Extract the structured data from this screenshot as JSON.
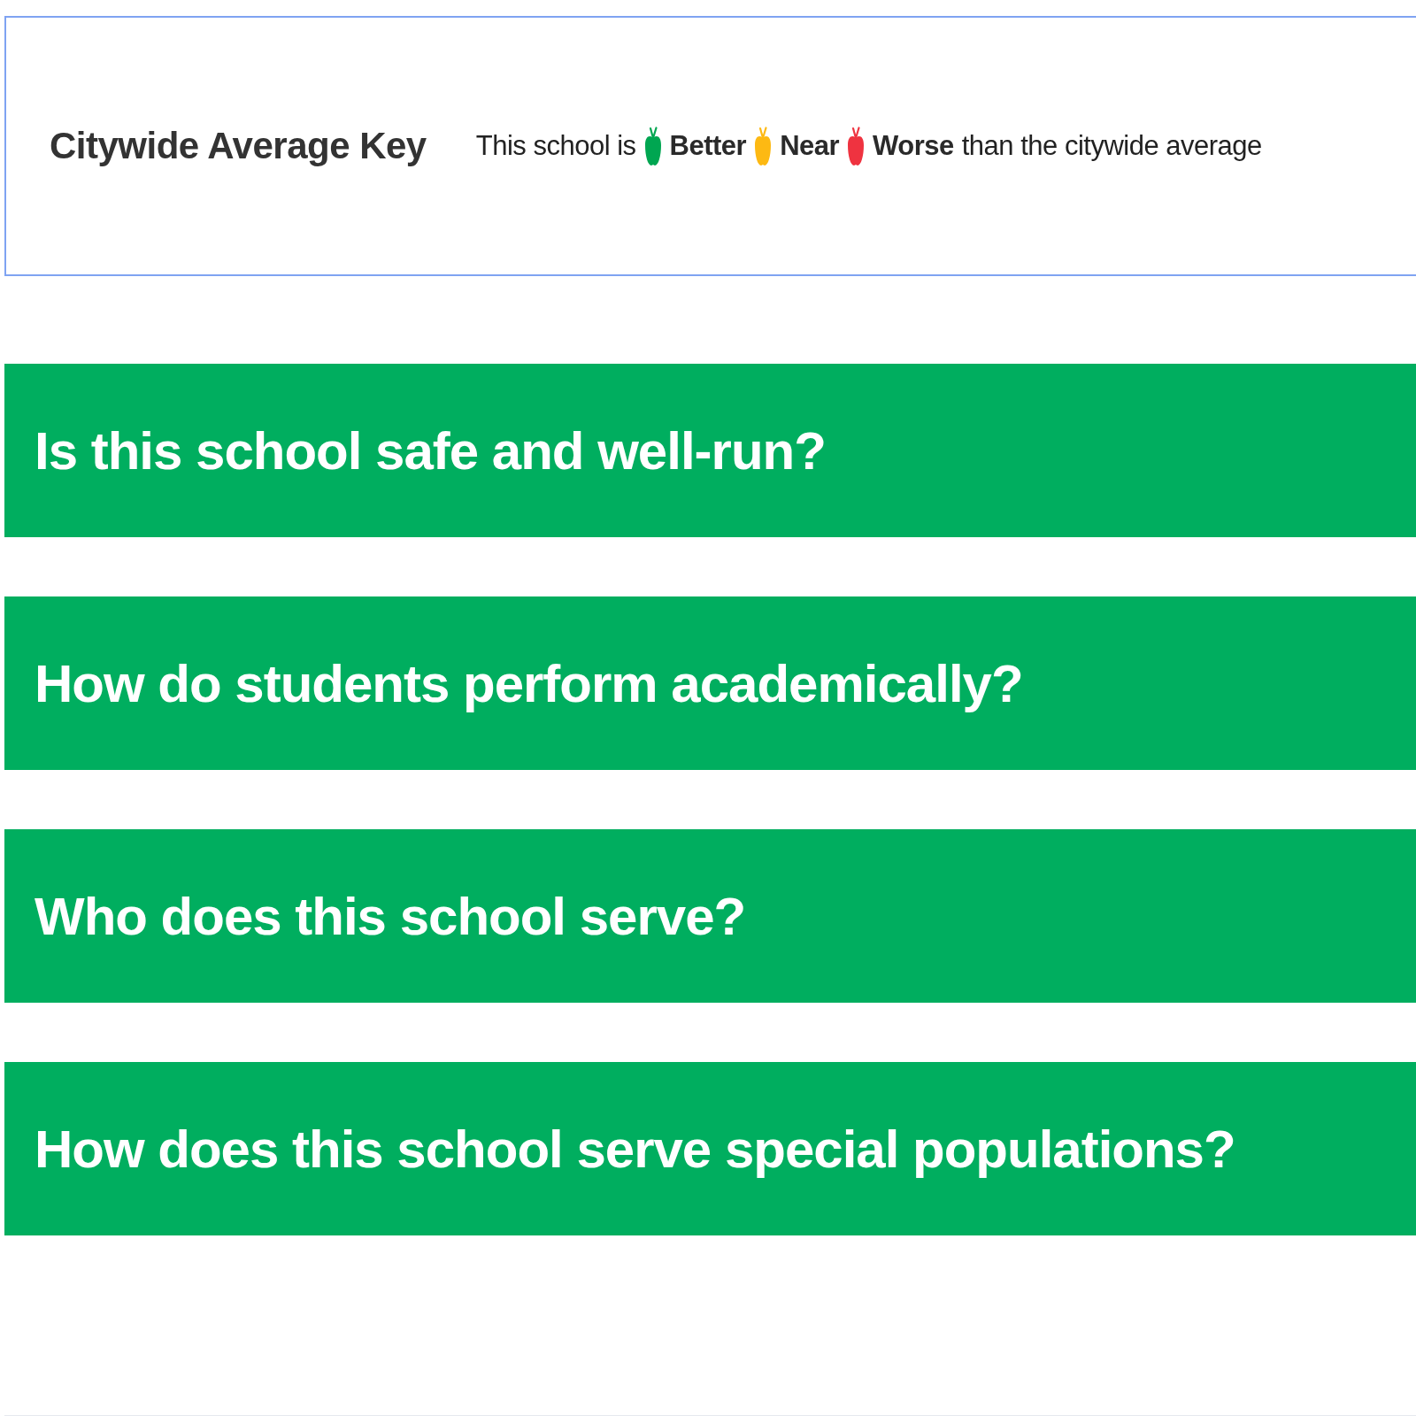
{
  "key": {
    "title": "Citywide Average Key",
    "intro": "This school is",
    "levels": [
      {
        "label": "Better",
        "color": "#00a651"
      },
      {
        "label": "Near",
        "color": "#fdb913"
      },
      {
        "label": "Worse",
        "color": "#ef3340"
      }
    ],
    "outro": "than the citywide average"
  },
  "sections": [
    {
      "title": "Is this school safe and well-run?"
    },
    {
      "title": "How do students perform academically?"
    },
    {
      "title": "Who does this school serve?"
    },
    {
      "title": "How does this school serve special populations?"
    }
  ]
}
